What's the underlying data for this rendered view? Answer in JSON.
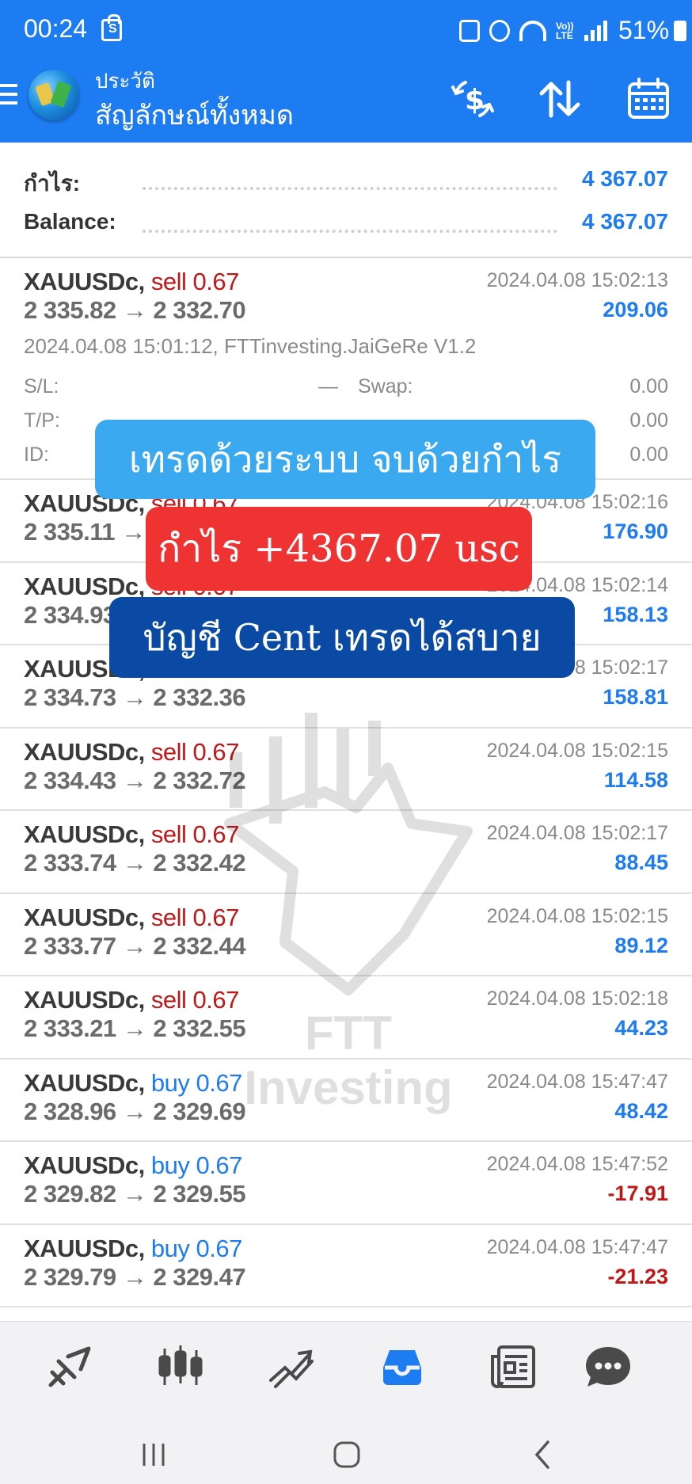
{
  "status_bar": {
    "time": "00:24",
    "shop_icon_letter": "S",
    "volte_label": "Vo)) LTE",
    "battery": "51%"
  },
  "app_bar": {
    "title_small": "ประวัติ",
    "title_big": "สัญลักษณ์ทั้งหมด",
    "icons": [
      "menu-icon",
      "app-logo",
      "deposit-withdraw-icon",
      "sort-icon",
      "calendar-icon"
    ]
  },
  "summary": {
    "profit_label": "กำไร:",
    "profit_value": "4 367.07",
    "balance_label": "Balance:",
    "balance_value": "4 367.07"
  },
  "expanded_trade": {
    "symbol": "XAUUSDc,",
    "side": "sell 0.67",
    "prices": "2 335.82 → 2 332.70",
    "close_time": "2024.04.08 15:02:13",
    "profit": "209.06",
    "open_info": "2024.04.08 15:01:12, FTTinvesting.JaiGeRe V1.2",
    "sl_label": "S/L:",
    "sl_value": "—",
    "swap_label": "Swap:",
    "swap_value": "0.00",
    "tp_label": "T/P:",
    "tp_value": "",
    "commission_value": "0.00",
    "id_label": "ID:",
    "fee_value": "0.00"
  },
  "trades": [
    {
      "symbol": "XAUUSDc,",
      "side": "sell",
      "side_label": "sell 0.67",
      "prices": "2 335.11 → 2 332.49",
      "time": "2024.04.08 15:02:16",
      "profit": "176.90"
    },
    {
      "symbol": "XAUUSDc,",
      "side": "sell",
      "side_label": "sell 0.67",
      "prices": "2 334.93 → 2 332.57",
      "time": "2024.04.08 15:02:14",
      "profit": "158.13"
    },
    {
      "symbol": "XAUUSDc,",
      "side": "sell",
      "side_label": "sell 0.67",
      "prices": "2 334.73 → 2 332.36",
      "time": "2024.04.08 15:02:17",
      "profit": "158.81"
    },
    {
      "symbol": "XAUUSDc,",
      "side": "sell",
      "side_label": "sell 0.67",
      "prices": "2 334.43 → 2 332.72",
      "time": "2024.04.08 15:02:15",
      "profit": "114.58"
    },
    {
      "symbol": "XAUUSDc,",
      "side": "sell",
      "side_label": "sell 0.67",
      "prices": "2 333.74 → 2 332.42",
      "time": "2024.04.08 15:02:17",
      "profit": "88.45"
    },
    {
      "symbol": "XAUUSDc,",
      "side": "sell",
      "side_label": "sell 0.67",
      "prices": "2 333.77 → 2 332.44",
      "time": "2024.04.08 15:02:15",
      "profit": "89.12"
    },
    {
      "symbol": "XAUUSDc,",
      "side": "sell",
      "side_label": "sell 0.67",
      "prices": "2 333.21 → 2 332.55",
      "time": "2024.04.08 15:02:18",
      "profit": "44.23"
    },
    {
      "symbol": "XAUUSDc,",
      "side": "buy",
      "side_label": "buy 0.67",
      "prices": "2 328.96 → 2 329.69",
      "time": "2024.04.08 15:47:47",
      "profit": "48.42"
    },
    {
      "symbol": "XAUUSDc,",
      "side": "buy",
      "side_label": "buy 0.67",
      "prices": "2 329.82 → 2 329.55",
      "time": "2024.04.08 15:47:52",
      "profit": "-17.91"
    },
    {
      "symbol": "XAUUSDc,",
      "side": "buy",
      "side_label": "buy 0.67",
      "prices": "2 329.79 → 2 329.47",
      "time": "2024.04.08 15:47:47",
      "profit": "-21.23"
    }
  ],
  "watermark": {
    "text": "FTT Investing"
  },
  "banners": {
    "line1": "เทรดด้วยระบบ จบด้วยกำไร",
    "line2": "กำไร +4367.07 usc",
    "line3": "บัญชี Cent เทรดได้สบาย"
  },
  "bottom_nav": {
    "items": [
      "quotes-icon",
      "chart-icon",
      "trade-icon",
      "history-icon",
      "news-icon",
      "chat-icon"
    ],
    "active": "history-icon"
  },
  "colors": {
    "accent": "#1e7cf2",
    "sell": "#c01818",
    "banner_light": "#3aa9f0",
    "banner_red": "#ef3232",
    "banner_dark": "#0a4aa5"
  }
}
